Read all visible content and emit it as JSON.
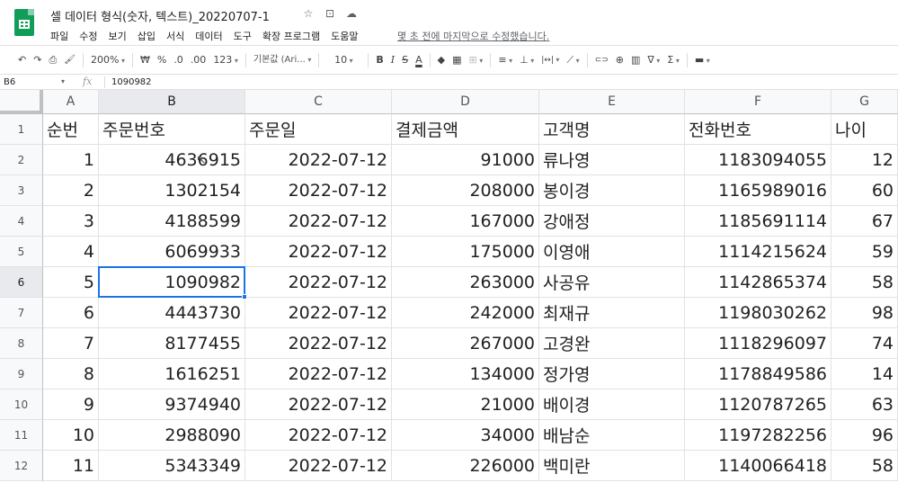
{
  "app": {
    "title": "셀 데이터 형식(숫자, 텍스트)_20220707-1",
    "menu": [
      "파일",
      "수정",
      "보기",
      "삽입",
      "서식",
      "데이터",
      "도구",
      "확장 프로그램",
      "도움말"
    ],
    "last_edit": "몇 초 전에 마지막으로 수정했습니다.",
    "title_icons": [
      "star-icon",
      "move-to-folder-icon",
      "cloud-status-icon"
    ]
  },
  "toolbar": {
    "undo": "↶",
    "redo": "↷",
    "print": "⎙",
    "paint_format": "🖌",
    "zoom": "200%",
    "currency": "₩",
    "percent": "%",
    "decrease_decimal": ".0",
    "increase_decimal": ".00",
    "number_format": "123",
    "font": "기본값 (Ari...",
    "font_size": "10",
    "bold": "B",
    "italic": "I",
    "strikethrough": "S",
    "text_color": "A",
    "fill_color": "◆",
    "borders": "▦",
    "merge": "⊞",
    "h_align": "≡",
    "v_align": "⊥",
    "wrap": "|↔|",
    "rotate": "⟋",
    "link": "⊂⊃",
    "comment": "⊕",
    "chart": "▥",
    "filter": "∇",
    "functions": "Σ",
    "input_tools": "▬"
  },
  "formula_bar": {
    "name_box": "B6",
    "fx": "fx",
    "value": "1090982"
  },
  "sheet": {
    "columns": [
      "A",
      "B",
      "C",
      "D",
      "E",
      "F",
      "G"
    ],
    "active_column": "B",
    "active_row": "6",
    "rows": [
      {
        "num": "1",
        "cells": [
          "순번",
          "주문번호",
          "주문일",
          "결제금액",
          "고객명",
          "전화번호",
          "나이"
        ]
      },
      {
        "num": "2",
        "cells": [
          "1",
          "4636915",
          "2022-07-12",
          "91000",
          "류나영",
          "1183094055",
          "12"
        ]
      },
      {
        "num": "3",
        "cells": [
          "2",
          "1302154",
          "2022-07-12",
          "208000",
          "봉이경",
          "1165989016",
          "60"
        ]
      },
      {
        "num": "4",
        "cells": [
          "3",
          "4188599",
          "2022-07-12",
          "167000",
          "강애정",
          "1185691114",
          "67"
        ]
      },
      {
        "num": "5",
        "cells": [
          "4",
          "6069933",
          "2022-07-12",
          "175000",
          "이영애",
          "1114215624",
          "59"
        ]
      },
      {
        "num": "6",
        "cells": [
          "5",
          "1090982",
          "2022-07-12",
          "263000",
          "사공유",
          "1142865374",
          "58"
        ]
      },
      {
        "num": "7",
        "cells": [
          "6",
          "4443730",
          "2022-07-12",
          "242000",
          "최재규",
          "1198030262",
          "98"
        ]
      },
      {
        "num": "8",
        "cells": [
          "7",
          "8177455",
          "2022-07-12",
          "267000",
          "고경완",
          "1118296097",
          "74"
        ]
      },
      {
        "num": "9",
        "cells": [
          "8",
          "1616251",
          "2022-07-12",
          "134000",
          "정가영",
          "1178849586",
          "14"
        ]
      },
      {
        "num": "10",
        "cells": [
          "9",
          "9374940",
          "2022-07-12",
          "21000",
          "배이경",
          "1120787265",
          "63"
        ]
      },
      {
        "num": "11",
        "cells": [
          "10",
          "2988090",
          "2022-07-12",
          "34000",
          "배남순",
          "1197282256",
          "96"
        ]
      },
      {
        "num": "12",
        "cells": [
          "11",
          "5343349",
          "2022-07-12",
          "226000",
          "백미란",
          "1140066418",
          "58"
        ]
      }
    ]
  },
  "colors": {
    "brand": "#0f9d58",
    "selection": "#1a73e8",
    "header_bg": "#f8f9fa",
    "active_header_bg": "#e8eaed"
  }
}
